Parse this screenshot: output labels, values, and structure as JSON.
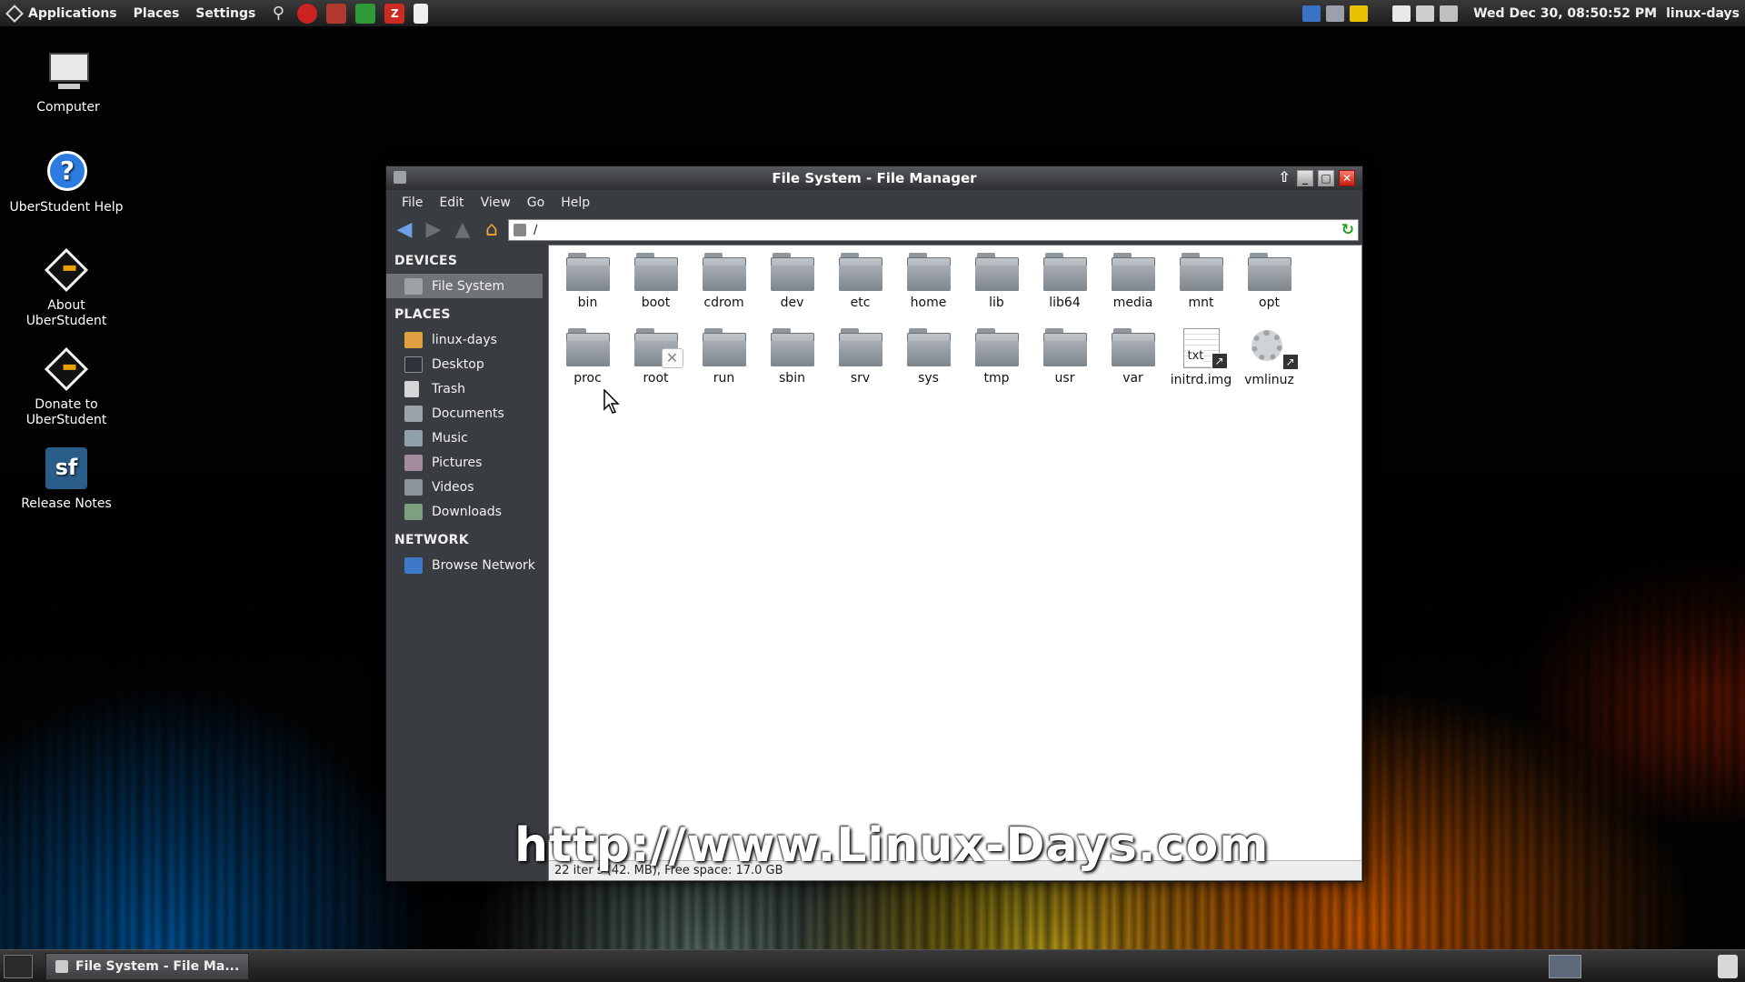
{
  "top_panel": {
    "menus": [
      "Applications",
      "Places",
      "Settings"
    ],
    "clock": "Wed Dec 30, 08:50:52 PM",
    "user": "linux-days"
  },
  "desktop_icons": [
    {
      "label": "Computer",
      "icon": "computer-icon"
    },
    {
      "label": "UberStudent Help",
      "icon": "help-icon"
    },
    {
      "label": "About UberStudent",
      "icon": "uberstudent-logo-icon"
    },
    {
      "label": "Donate to UberStudent",
      "icon": "uberstudent-logo-icon"
    },
    {
      "label": "Release Notes",
      "icon": "sourceforge-icon"
    }
  ],
  "window": {
    "title": "File System - File Manager",
    "menu": [
      "File",
      "Edit",
      "View",
      "Go",
      "Help"
    ],
    "location": "/",
    "sidebar": {
      "devices_heading": "DEVICES",
      "devices": [
        {
          "label": "File System",
          "selected": true
        }
      ],
      "places_heading": "PLACES",
      "places": [
        {
          "label": "linux-days",
          "icon": "home-icon"
        },
        {
          "label": "Desktop",
          "icon": "desktop-icon"
        },
        {
          "label": "Trash",
          "icon": "trash-icon"
        },
        {
          "label": "Documents",
          "icon": "folder-icon"
        },
        {
          "label": "Music",
          "icon": "music-folder-icon"
        },
        {
          "label": "Pictures",
          "icon": "pictures-folder-icon"
        },
        {
          "label": "Videos",
          "icon": "videos-folder-icon"
        },
        {
          "label": "Downloads",
          "icon": "downloads-folder-icon"
        }
      ],
      "network_heading": "NETWORK",
      "network": [
        {
          "label": "Browse Network",
          "icon": "network-icon"
        }
      ]
    },
    "files": [
      {
        "name": "bin",
        "type": "folder"
      },
      {
        "name": "boot",
        "type": "folder"
      },
      {
        "name": "cdrom",
        "type": "folder"
      },
      {
        "name": "dev",
        "type": "folder"
      },
      {
        "name": "etc",
        "type": "folder"
      },
      {
        "name": "home",
        "type": "folder"
      },
      {
        "name": "lib",
        "type": "folder"
      },
      {
        "name": "lib64",
        "type": "folder"
      },
      {
        "name": "media",
        "type": "folder"
      },
      {
        "name": "mnt",
        "type": "folder"
      },
      {
        "name": "opt",
        "type": "folder"
      },
      {
        "name": "proc",
        "type": "folder"
      },
      {
        "name": "root",
        "type": "folder-locked"
      },
      {
        "name": "run",
        "type": "folder"
      },
      {
        "name": "sbin",
        "type": "folder"
      },
      {
        "name": "srv",
        "type": "folder"
      },
      {
        "name": "sys",
        "type": "folder"
      },
      {
        "name": "tmp",
        "type": "folder"
      },
      {
        "name": "usr",
        "type": "folder"
      },
      {
        "name": "var",
        "type": "folder"
      },
      {
        "name": "initrd.img",
        "type": "text-link"
      },
      {
        "name": "vmlinuz",
        "type": "executable-link"
      }
    ],
    "doc_glyph": "txt",
    "status": "22 iter s (42. MB), Free space: 17.0 GB"
  },
  "watermark": "http://www.Linux-Days.com",
  "taskbar": {
    "tasks": [
      "File System - File Ma..."
    ]
  }
}
